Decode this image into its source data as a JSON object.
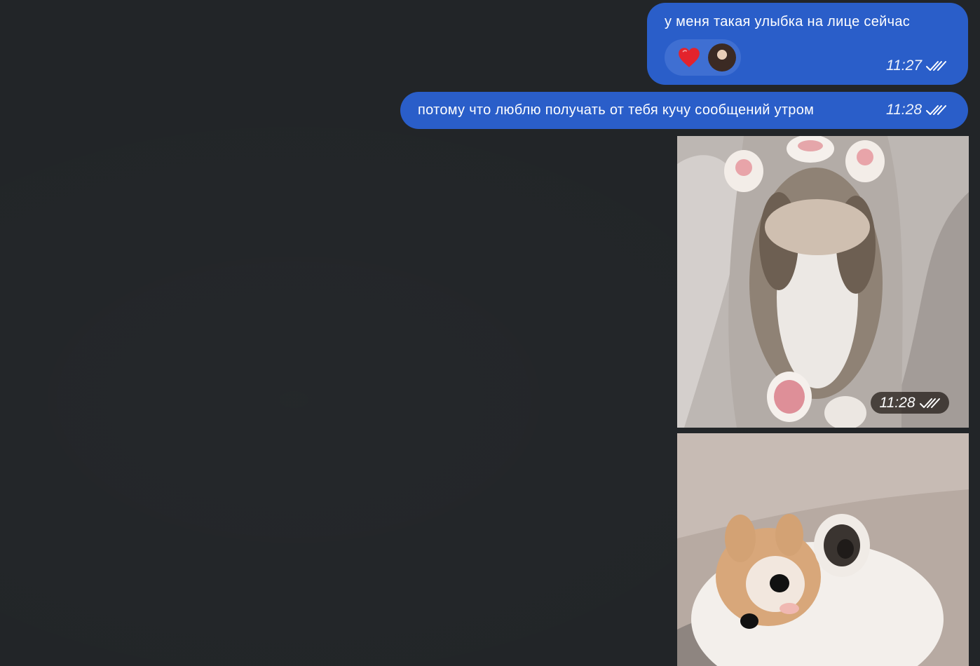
{
  "messages": [
    {
      "text": "у меня такая улыбка на лице сейчас",
      "time": "11:27",
      "status": "double-check-read",
      "reactions": [
        {
          "emoji": "heart",
          "color": "#e3232c",
          "avatar": "reaction-user-avatar"
        }
      ]
    },
    {
      "text": "потому что люблю получать от тебя кучу сообщений утром",
      "time": "11:28",
      "status": "double-check-read"
    },
    {
      "type": "photo",
      "description": "kitten-on-back",
      "time": "11:28",
      "status": "double-check-read"
    },
    {
      "type": "photo",
      "description": "kitten-raising-paw"
    }
  ],
  "colors": {
    "background": "#222528",
    "outgoing_bubble": "#2a5ec9",
    "reaction_pill": "#3f6fd2",
    "heart": "#e3232c",
    "text": "#ffffff"
  },
  "icons": {
    "read_status": "double-check-icon",
    "reaction": "heart-icon"
  }
}
